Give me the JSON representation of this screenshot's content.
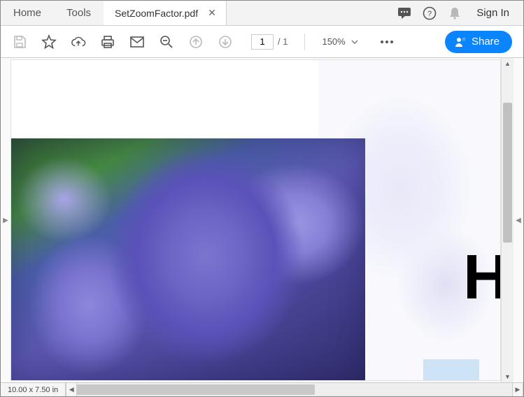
{
  "menubar": {
    "home": "Home",
    "tools": "Tools",
    "doc_title": "SetZoomFactor.pdf",
    "signin": "Sign In"
  },
  "toolbar": {
    "page_current": "1",
    "page_total": "/  1",
    "zoom_level": "150%",
    "share_label": "Share"
  },
  "statusbar": {
    "dimensions": "10.00 x 7.50 in"
  },
  "icons": {
    "save": "save-icon",
    "star": "star-icon",
    "cloud": "cloud-upload-icon",
    "print": "print-icon",
    "mail": "mail-icon",
    "zoomout": "zoom-out-icon",
    "pageup": "page-up-icon",
    "pagedown": "page-down-icon",
    "more": "more-icon",
    "comment": "comment-icon",
    "help": "help-icon",
    "bell": "bell-icon"
  }
}
